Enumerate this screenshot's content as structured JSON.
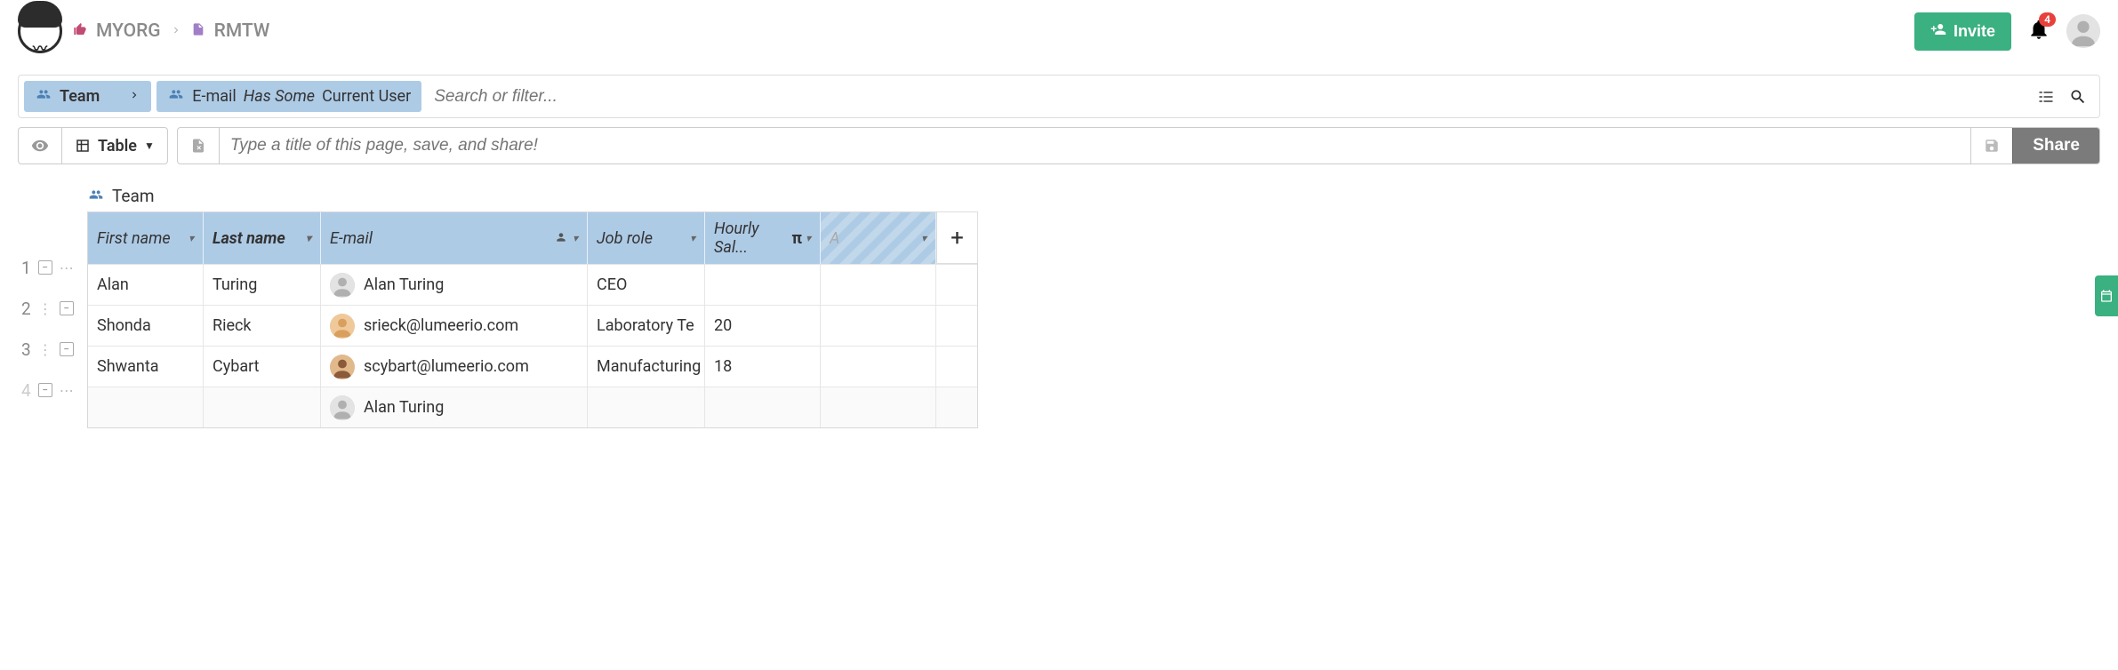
{
  "breadcrumb": {
    "org": "MYORG",
    "project": "RMTW"
  },
  "header": {
    "invite_label": "Invite",
    "notification_count": "4"
  },
  "filter_bar": {
    "team_chip": "Team",
    "filter_field": "E-mail",
    "filter_op": "Has Some",
    "filter_value": "Current User",
    "search_placeholder": "Search or filter..."
  },
  "view_bar": {
    "view_label": "Table",
    "title_placeholder": "Type a title of this page, save, and share!",
    "share_label": "Share"
  },
  "table": {
    "title": "Team",
    "columns": [
      {
        "label": "First name",
        "bold": false
      },
      {
        "label": "Last name",
        "bold": true
      },
      {
        "label": "E-mail",
        "bold": false,
        "icon": "user"
      },
      {
        "label": "Job role",
        "bold": false
      },
      {
        "label": "Hourly Sal...",
        "bold": false,
        "icon": "pi"
      },
      {
        "label": "A",
        "bold": false,
        "stripe": true
      }
    ],
    "rows": [
      {
        "num": "1",
        "first": "Alan",
        "last": "Turing",
        "email": "Alan Turing",
        "role": "CEO",
        "salary": "",
        "avatar": "gray"
      },
      {
        "num": "2",
        "first": "Shonda",
        "last": "Rieck",
        "email": "srieck@lumeerio.com",
        "role": "Laboratory Te",
        "salary": "20",
        "avatar": "orange"
      },
      {
        "num": "3",
        "first": "Shwanta",
        "last": "Cybart",
        "email": "scybart@lumeerio.com",
        "role": "Manufacturing",
        "salary": "18",
        "avatar": "brown"
      },
      {
        "num": "4",
        "first": "",
        "last": "",
        "email": "Alan Turing",
        "role": "",
        "salary": "",
        "avatar": "gray",
        "faded": true
      }
    ]
  }
}
